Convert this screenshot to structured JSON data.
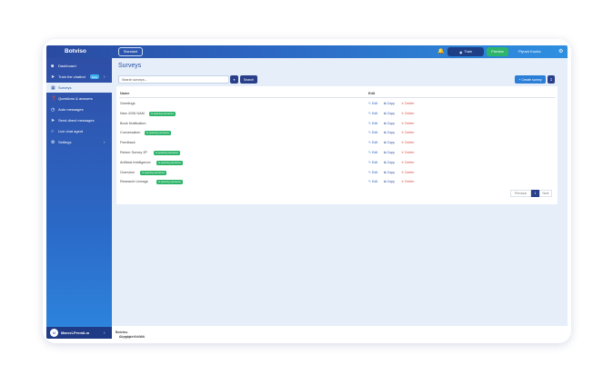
{
  "app": {
    "logo": "Botviso"
  },
  "topbar": {
    "plan_label": "Standard",
    "train_label": "Train",
    "preview_label": "Preview",
    "user_name": "Piyush Kucha"
  },
  "sidebar": {
    "items": [
      {
        "label": "Dashboard",
        "icon": "dashboard-icon"
      },
      {
        "label": "Train the chatbot",
        "icon": "rocket-icon",
        "badge": "beta"
      },
      {
        "label": "Surveys",
        "icon": "survey-icon"
      },
      {
        "label": "Questions & answers",
        "icon": "question-icon"
      },
      {
        "label": "Auto messages",
        "icon": "clock-icon"
      },
      {
        "label": "Send direct messages",
        "icon": "send-icon"
      },
      {
        "label": "Live chat agent",
        "icon": "chat-icon"
      },
      {
        "label": "Settings",
        "icon": "gear-icon"
      }
    ],
    "footer_name": "Marvel-PremiLm",
    "footer_avatar": "M"
  },
  "main": {
    "title": "Surveys",
    "search_placeholder": "Search surveys...",
    "search_button": "Search",
    "create_button": "+ Create survey",
    "columns": {
      "name": "Name",
      "edit": "Edit"
    },
    "actions": {
      "edit": "Edit",
      "copy": "Copy",
      "delete": "Delete"
    },
    "rows": [
      {
        "name": "Greetings",
        "badge": ""
      },
      {
        "name": "New JOIN NAM",
        "badge": "is opening sentence"
      },
      {
        "name": "Book Notification",
        "badge": ""
      },
      {
        "name": "Conversation",
        "badge": "is opening sentence"
      },
      {
        "name": "Feedback",
        "badge": ""
      },
      {
        "name": "Return Survey 2P",
        "badge": "is opening sentence"
      },
      {
        "name": "Artificial Intelligence",
        "badge": "is opening sentence"
      },
      {
        "name": "Overview",
        "badge": "is opening sentence"
      },
      {
        "name": "Research Lineage",
        "badge": "is opening sentence"
      }
    ],
    "pagination": {
      "previous": "Previous",
      "current": "1",
      "next": "Next"
    }
  },
  "footer": {
    "prefix": "Copyright © 2025",
    "brand": "Botviso.",
    "suffix": " All rights reserved."
  },
  "colors": {
    "accent": "#2b4fa3",
    "success": "#2fb56b",
    "danger": "#e0524b"
  }
}
